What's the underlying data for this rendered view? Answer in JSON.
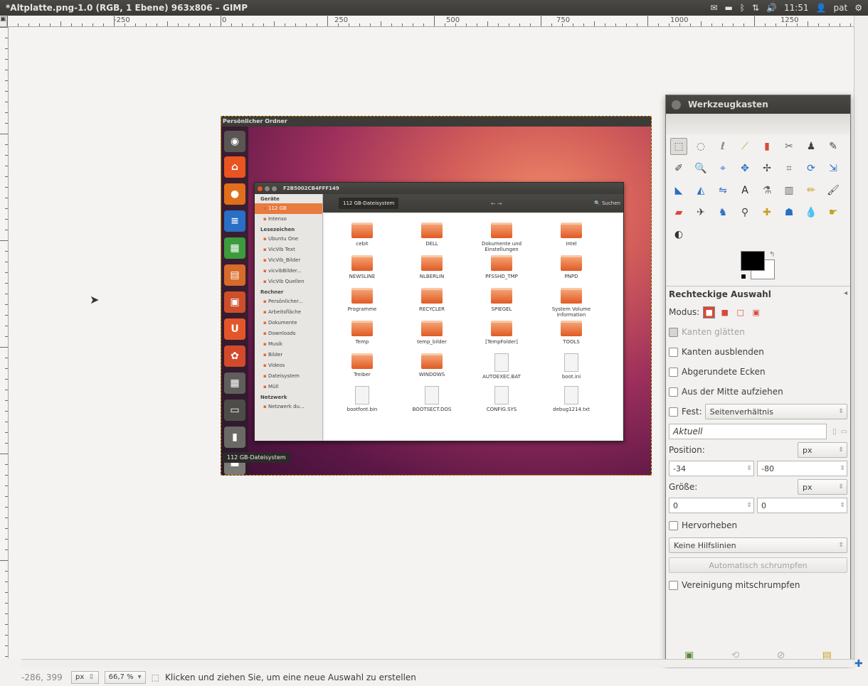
{
  "window": {
    "title": "*Altplatte.png-1.0 (RGB, 1 Ebene) 963x806 – GIMP"
  },
  "panel": {
    "mail_icon": "mail-icon",
    "battery_icon": "battery-icon",
    "bluetooth_icon": "bluetooth-icon",
    "network_icon": "network-icon",
    "volume_icon": "volume-icon",
    "time": "11:51",
    "user": "pat",
    "power_icon": "power-icon"
  },
  "ruler": {
    "labels": [
      "-250",
      "0",
      "250",
      "500",
      "750",
      "1000",
      "1250"
    ]
  },
  "image": {
    "title": "Persönlicher Ordner",
    "tooltip": "112 GB-Dateisystem",
    "nautilus": {
      "title": "F2B5002CB4FFF149",
      "crumb": "112 GB-Dateisystem",
      "search": "Suchen",
      "sections": [
        {
          "header": "Geräte",
          "items": [
            "112 GB",
            "Intenso"
          ]
        },
        {
          "header": "Lesezeichen",
          "items": [
            "Ubuntu One",
            "VicVib Text",
            "VicVib_Bilder",
            "vicvibBilder...",
            "VicVib Quellen"
          ]
        },
        {
          "header": "Rechner",
          "items": [
            "Persönlicher...",
            "Arbeitsfläche",
            "Dokumente",
            "Downloads",
            "Musik",
            "Bilder",
            "Videos",
            "Dateisystem",
            "Müll"
          ]
        },
        {
          "header": "Netzwerk",
          "items": [
            "Netzwerk du..."
          ]
        }
      ],
      "files": [
        [
          "cebit",
          "DELL",
          "Dokumente und Einstellungen",
          "Intel"
        ],
        [
          "NEWSLINE",
          "NLBERLIN",
          "PFSSHD_TMP",
          "PNPD"
        ],
        [
          "Programme",
          "RECYCLER",
          "SPIEGEL",
          "System Volume Information"
        ],
        [
          "Temp",
          "temp_bilder",
          "[TempFolder]",
          "TOOLS"
        ],
        [
          "Treiber",
          "WINDOWS",
          "AUTOEXEC.BAT",
          "boot.ini"
        ],
        [
          "bootfont.bin",
          "BOOTSECT.DOS",
          "CONFIG.SYS",
          "debug1214.txt"
        ]
      ]
    }
  },
  "toolbox": {
    "title": "Werkzeugkasten",
    "options_title": "Rechteckige Auswahl",
    "mode_label": "Modus:",
    "antialias": "Kanten glätten",
    "feather": "Kanten ausblenden",
    "rounded": "Abgerundete Ecken",
    "from_center": "Aus der Mitte aufziehen",
    "fixed_label": "Fest:",
    "fixed_value": "Seitenverhältnis",
    "aktuell": "Aktuell",
    "position_label": "Position:",
    "position_unit": "px",
    "position_x": "-34",
    "position_y": "-80",
    "size_label": "Größe:",
    "size_unit": "px",
    "size_w": "0",
    "size_h": "0",
    "highlight": "Hervorheben",
    "guides": "Keine Hilfslinien",
    "autoshrink": "Automatisch schrumpfen",
    "shrink_merged": "Vereinigung mitschrumpfen"
  },
  "status": {
    "coords": "-286, 399",
    "unit": "px",
    "zoom": "66,7 %",
    "message": "Klicken und ziehen Sie, um eine neue Auswahl zu erstellen"
  }
}
